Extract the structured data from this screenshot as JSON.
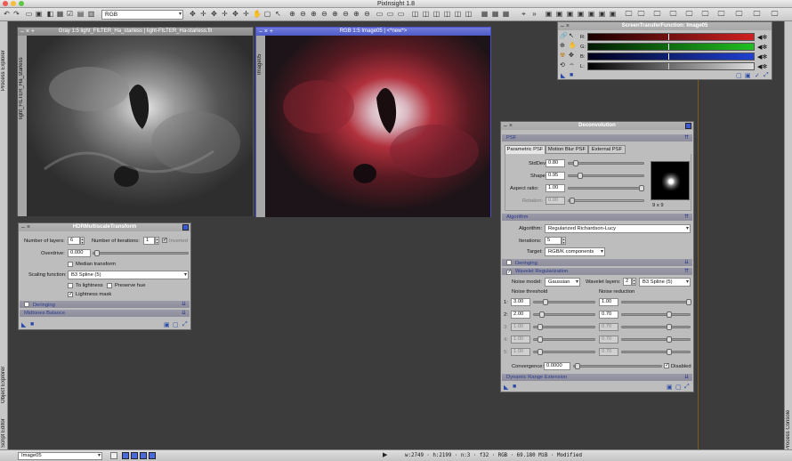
{
  "app": {
    "title": "PixInsight 1.8"
  },
  "toolbar": {
    "color_space": "RGB"
  },
  "sidebars": {
    "left_top": "Process Explorer",
    "left_mid": "Object Explorer",
    "left_bottom": "Script Editor",
    "right_bottom": "Process Console"
  },
  "windows": {
    "gray": {
      "title": "Gray 1:5 light_FILTER_Ha_starless | light-FILTER_Ha-starless.fit",
      "side": "light_FILTER_Ha_starless"
    },
    "rgb": {
      "title": "RGB 1:5 Image05 | <*new*>",
      "side": "Image05"
    }
  },
  "stf": {
    "title": "ScreenTransferFunction: Image05",
    "channels": [
      "R:",
      "G:",
      "B:",
      "L:"
    ]
  },
  "hdr": {
    "title": "HDRMultiscaleTransform",
    "layers_label": "Number of layers:",
    "layers_value": "6",
    "iter_label": "Number of iterations:",
    "iter_value": "1",
    "inverted_label": "Inverted",
    "overdrive_label": "Overdrive:",
    "overdrive_value": "0.000",
    "median_label": "Median transform",
    "scaling_label": "Scaling function:",
    "scaling_value": "B3 Spline (5)",
    "to_lightness_label": "To lightness",
    "preserve_hue_label": "Preserve hue",
    "lightness_mask_label": "Lightness mask",
    "deringing_label": "Deringing",
    "midtones_label": "Midtones Balance"
  },
  "deconv": {
    "title": "Deconvolution",
    "psf_section": "PSF",
    "tabs": [
      "Parametric PSF",
      "Motion Blur PSF",
      "External PSF"
    ],
    "stddev_label": "StdDev:",
    "stddev_value": "0.80",
    "shape_label": "Shape:",
    "shape_value": "0.95",
    "aspect_label": "Aspect ratio:",
    "aspect_value": "1.00",
    "rotation_label": "Rotation:",
    "rotation_value": "0.00",
    "psf_size": "9 x 9",
    "algorithm_section": "Algorithm",
    "algorithm_label": "Algorithm:",
    "algorithm_value": "Regularized Richardson-Lucy",
    "iterations_label": "Iterations:",
    "iterations_value": "5",
    "target_label": "Target:",
    "target_value": "RGB/K components",
    "deringing_label": "Deringing",
    "wavelet_label": "Wavelet Regularization",
    "noise_model_label": "Noise model:",
    "noise_model_value": "Gaussian",
    "wavelet_layers_label": "Wavelet layers:",
    "wavelet_layers_value": "2",
    "wavelet_scaling_value": "B3 Spline (5)",
    "noise_threshold_label": "Noise threshold",
    "noise_reduction_label": "Noise reduction",
    "rows": [
      {
        "n": "1:",
        "thr": "3.00",
        "red": "1.00",
        "enabled": true
      },
      {
        "n": "2:",
        "thr": "2.00",
        "red": "0.70",
        "enabled": true
      },
      {
        "n": "3:",
        "thr": "1.00",
        "red": "0.70",
        "enabled": false
      },
      {
        "n": "4:",
        "thr": "1.00",
        "red": "0.70",
        "enabled": false
      },
      {
        "n": "5:",
        "thr": "1.00",
        "red": "0.70",
        "enabled": false
      }
    ],
    "convergence_label": "Convergence:",
    "convergence_value": "0.0000",
    "disabled_label": "Disabled",
    "dynamic_range_label": "Dynamic Range Extension"
  },
  "status": {
    "view_value": "Image05",
    "info": "w:2749 · h:2199 · n:3 · f32 · RGB · 69.180 MiB · Modified"
  },
  "colors": {
    "accent": "#6e7ed8",
    "section_text": "#2a3a8c"
  }
}
